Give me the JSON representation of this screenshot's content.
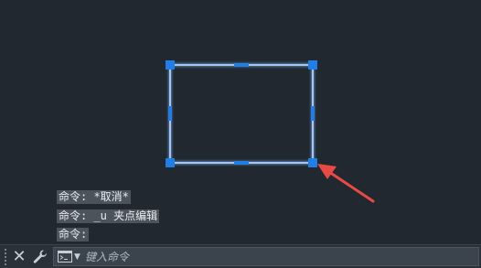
{
  "canvas": {
    "background": "#212830",
    "rectangle_color": "#9ec8ff",
    "grip_color": "#1f7ee8",
    "arrow_color": "#e94a43"
  },
  "command_history": [
    "命令: *取消*",
    "命令: _u 夹点编辑",
    "命令:"
  ],
  "command_line": {
    "placeholder": "键入命令",
    "close_icon": "close-icon",
    "customize_icon": "wrench-icon",
    "prompt_icon": "command-prompt-icon"
  }
}
